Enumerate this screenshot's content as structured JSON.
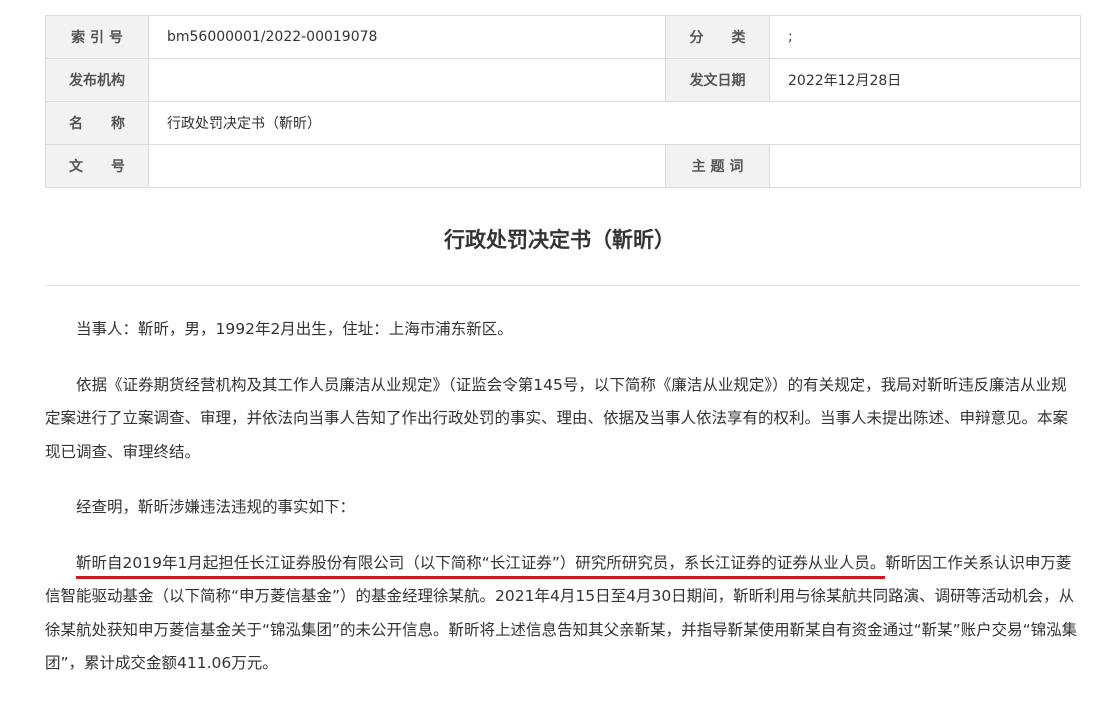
{
  "meta": {
    "index_label": "索 引 号",
    "index_value": "bm56000001/2022-00019078",
    "category_label": "分　　类",
    "category_value": ";",
    "publisher_label": "发布机构",
    "publisher_value": "",
    "date_label": "发文日期",
    "date_value": "2022年12月28日",
    "name_label": "名　　称",
    "name_value": "行政处罚决定书（靳昕）",
    "docno_label": "文　　号",
    "docno_value": "",
    "subject_label": "主 题 词",
    "subject_value": ""
  },
  "document": {
    "title": "行政处罚决定书（靳昕）",
    "p1": "当事人：靳昕，男，1992年2月出生，住址：上海市浦东新区。",
    "p2": "依据《证券期货经营机构及其工作人员廉洁从业规定》（证监会令第145号，以下简称《廉洁从业规定》）的有关规定，我局对靳昕违反廉洁从业规定案进行了立案调查、审理，并依法向当事人告知了作出行政处罚的事实、理由、依据及当事人依法享有的权利。当事人未提出陈述、申辩意见。本案现已调查、审理终结。",
    "p3": "经查明，靳昕涉嫌违法违规的事实如下：",
    "p4_highlight": "靳昕自2019年1月起担任长江证券股份有限公司（以下简称“长江证券”）研究所研究员，系长江证券的证券从业人员。",
    "p4_rest": "靳昕因工作关系认识申万菱信智能驱动基金（以下简称“申万菱信基金”）的基金经理徐某航。2021年4月15日至4月30日期间，靳昕利用与徐某航共同路演、调研等活动机会，从徐某航处获知申万菱信基金关于“锦泓集团”的未公开信息。靳昕将上述信息告知其父亲靳某，并指导靳某使用靳某自有资金通过“靳某”账户交易“锦泓集团”，累计成交金额411.06万元。"
  },
  "colors": {
    "underline": "#d0191f",
    "label_bg": "#f2f2f2",
    "border": "#dcdcdc"
  }
}
